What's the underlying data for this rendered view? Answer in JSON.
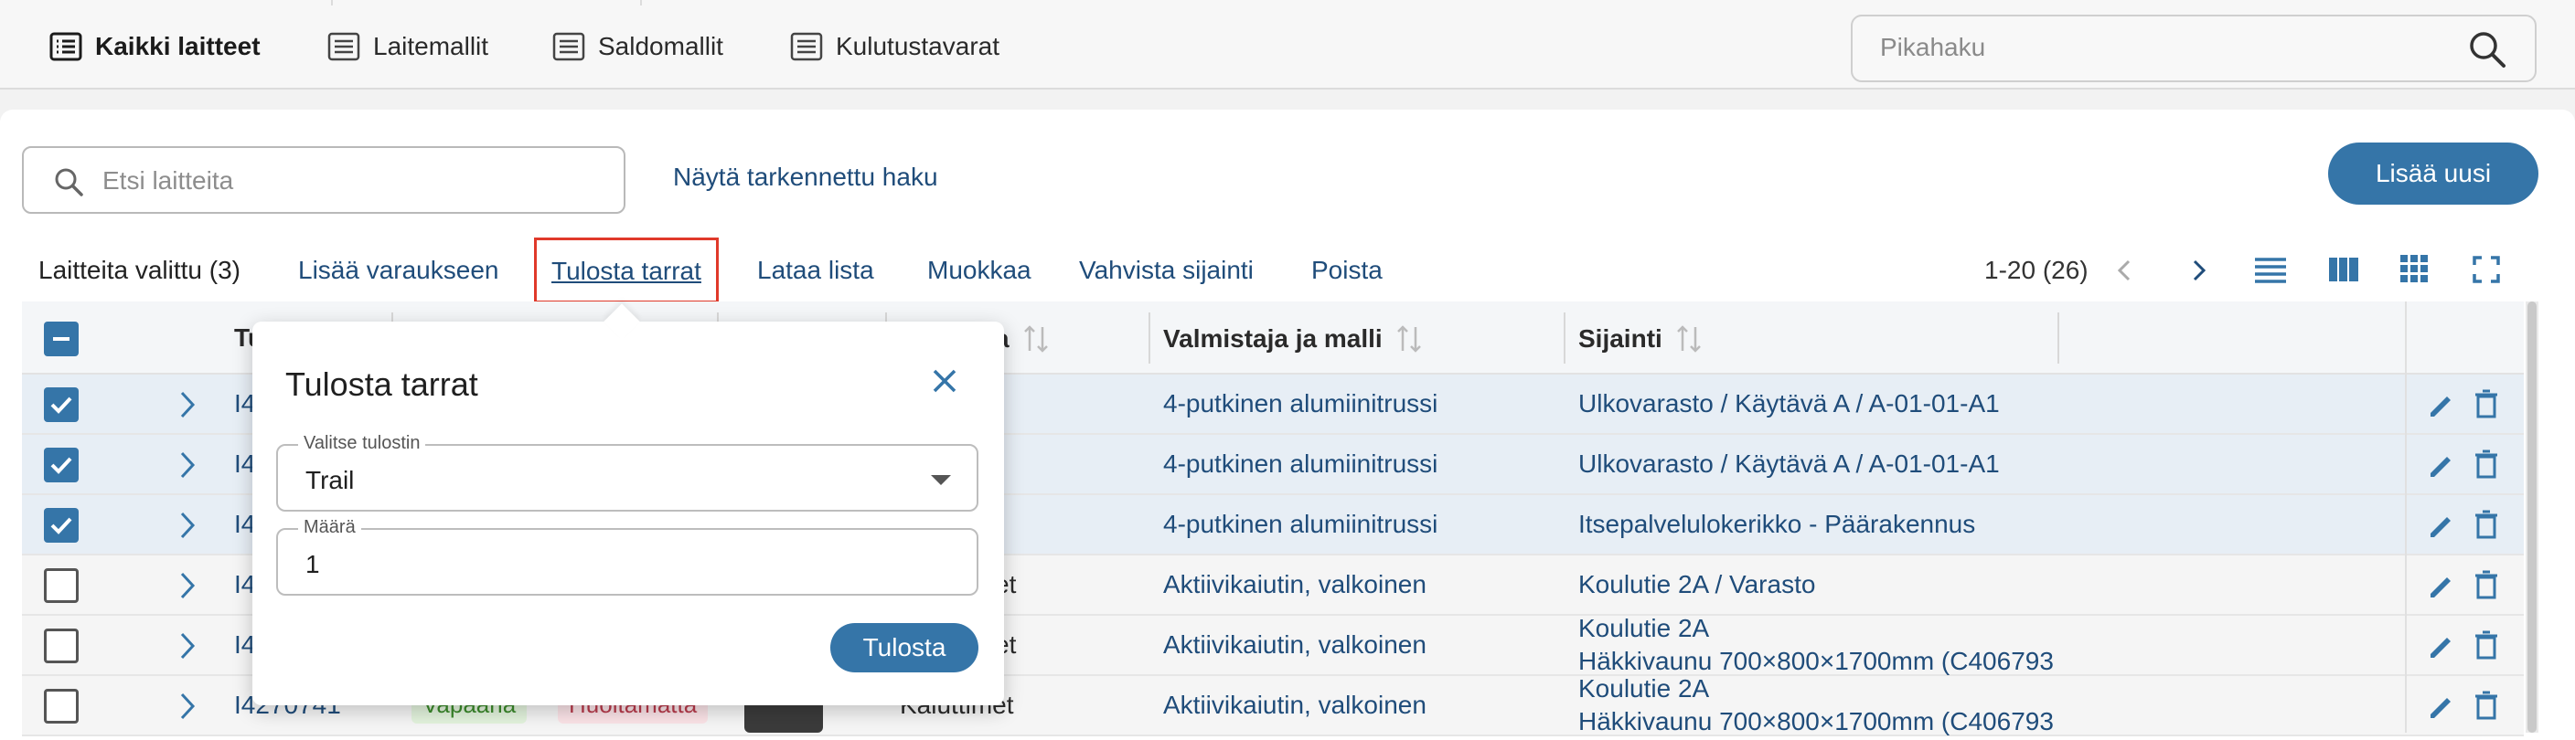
{
  "nav": {
    "tabs": [
      {
        "label": "Kaikki laitteet",
        "icon": "list-icon"
      },
      {
        "label": "Laitemallit",
        "icon": "list-icon"
      },
      {
        "label": "Saldomallit",
        "icon": "list-icon"
      },
      {
        "label": "Kulutustavarat",
        "icon": "list-icon"
      }
    ],
    "quick_search_placeholder": "Pikahaku"
  },
  "toolbar": {
    "search_placeholder": "Etsi laitteita",
    "advanced_search_label": "Näytä tarkennettu haku",
    "add_new_label": "Lisää uusi"
  },
  "actions": {
    "selected_label": "Laitteita valittu (3)",
    "add_to_reservation": "Lisää varaukseen",
    "print_labels": "Tulosta tarrat",
    "download_list": "Lataa lista",
    "edit": "Muokkaa",
    "confirm_location": "Vahvista sijainti",
    "delete": "Poista"
  },
  "pagination": {
    "range": "1-20 (26)"
  },
  "table": {
    "headers": {
      "col_t": "Tu",
      "col_category": "a",
      "col_manufacturer": "Valmistaja ja malli",
      "col_location": "Sijainti"
    },
    "rows": [
      {
        "selected": true,
        "id": "I4",
        "category": "",
        "manufacturer": "4-putkinen alumiinitrussi",
        "location": "Ulkovarasto / Käytävä A / A-01-01-A1",
        "location2": ""
      },
      {
        "selected": true,
        "id": "I4",
        "category": "",
        "manufacturer": "4-putkinen alumiinitrussi",
        "location": "Ulkovarasto / Käytävä A / A-01-01-A1",
        "location2": ""
      },
      {
        "selected": true,
        "id": "I4",
        "category": "",
        "manufacturer": "4-putkinen alumiinitrussi",
        "location": "Itsepalvelulokerikko - Päärakennus",
        "location2": ""
      },
      {
        "selected": false,
        "id": "I4",
        "category": "et",
        "manufacturer": "Aktiivikaiutin, valkoinen",
        "location": "Koulutie 2A / Varasto",
        "location2": ""
      },
      {
        "selected": false,
        "id": "I4",
        "category": "et",
        "manufacturer": "Aktiivikaiutin, valkoinen",
        "location": "Koulutie 2A",
        "location2": "Häkkivaunu 700×800×1700mm (C406793"
      },
      {
        "selected": false,
        "id": "I4270741",
        "status1": "Vapaana",
        "status2": "Huoltamatta",
        "category": "Kaiuttimet",
        "manufacturer": "Aktiivikaiutin, valkoinen",
        "location": "Koulutie 2A",
        "location2": "Häkkivaunu 700×800×1700mm (C406793"
      }
    ]
  },
  "print_dialog": {
    "title": "Tulosta tarrat",
    "printer_label": "Valitse tulostin",
    "printer_value": "Trail",
    "quantity_label": "Määrä",
    "quantity_value": "1",
    "submit_label": "Tulosta"
  },
  "colors": {
    "accent": "#3575a8",
    "link": "#1f4c7a",
    "highlight": "#e0392a",
    "selected_row": "#e7eef5"
  }
}
